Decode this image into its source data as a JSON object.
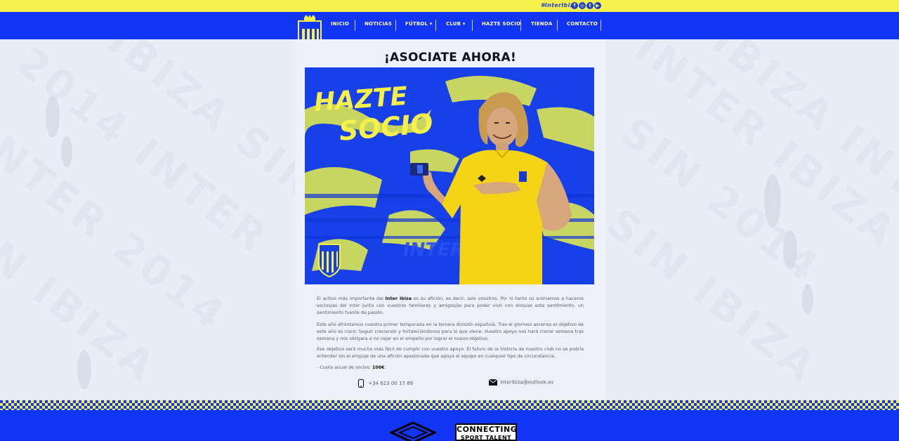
{
  "topbar": {
    "hashtag": "#InterIbiza",
    "social": [
      {
        "icon": "facebook-icon",
        "glyph": "f"
      },
      {
        "icon": "instagram-icon",
        "glyph": "◎"
      },
      {
        "icon": "twitter-icon",
        "glyph": "t"
      },
      {
        "icon": "youtube-icon",
        "glyph": "▶"
      }
    ]
  },
  "nav": {
    "items": [
      {
        "label": "INICIO"
      },
      {
        "label": "NOTICIAS"
      },
      {
        "label": "FÚTBOL ▾"
      },
      {
        "label": "CLUB ▾"
      },
      {
        "label": "HAZTE SOCIO"
      },
      {
        "label": "TIENDA"
      },
      {
        "label": "CONTACTO"
      }
    ]
  },
  "crest": {
    "text": "INTER IBIZA C.D."
  },
  "main": {
    "title": "¡ASOCIATE AHORA!",
    "hero": {
      "headline_1": "HAZTE",
      "headline_2": "SOCIO",
      "watermark": "INTER IBIZA"
    },
    "paragraphs": {
      "p1_a": "El activo más importante del ",
      "p1_b": "Inter Ibiza",
      "p1_c": " es su afición, es decir, sois vosotros. Por lo tanto os animamos a haceros socios/as del Inter junto con vuestros familiares y amigos/as para poder vivir con ellos/as este sentimiento, un sentimiento fuente de pasión.",
      "p2": "Este año afrontamos nuestra primer temporada en la tercera división española. Tras el glorioso ascenso el objetivo de este año es claro: Seguir creciendo y fortaleciéndonos para lo que viene. Vuestro apoyo nos hará crecer semana tras semana y nos obligara a no cejar en el empeño por lograr el nuevo objetivo.",
      "p3": "Ese objetivo será mucho más fácil de cumplir con vuestro apoyo. El futuro de la historia de nuestro club no se podría entender sin el empuje de una afición apasionada que apoya al equipo en cualquier tipo de circunstancia.",
      "fee_label": "- Cuota anual de socios: ",
      "fee_value": "100€"
    },
    "contact": {
      "phone": "+34 623 00 17 89",
      "email": "interibiza@outlook.es"
    }
  },
  "footer": {
    "sponsor": "CONNECTING",
    "sponsor_sub": "SPORT TALENT"
  },
  "colors": {
    "blue": "#1234f4",
    "yellow": "#f6f14a",
    "jersey": "#f5d315"
  }
}
